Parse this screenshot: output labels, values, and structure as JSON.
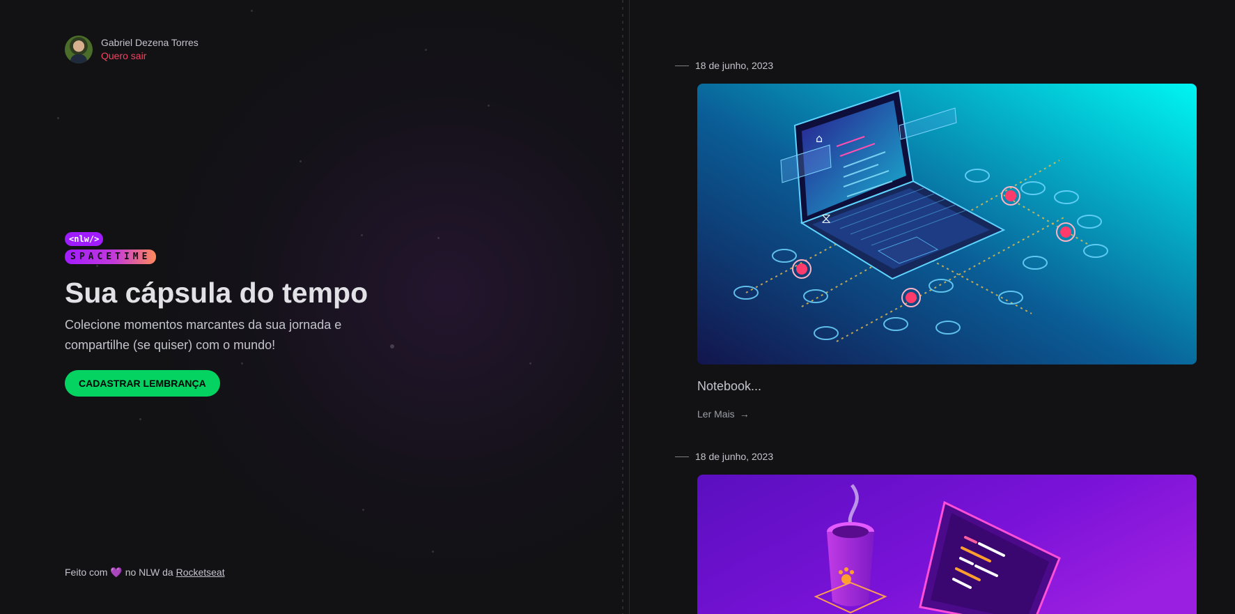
{
  "profile": {
    "name": "Gabriel Dezena Torres",
    "logout_label": "Quero sair"
  },
  "logo": {
    "badge": "<nlw/>",
    "word": "SPACETIME"
  },
  "hero": {
    "title": "Sua cápsula do tempo",
    "description": "Colecione momentos marcantes da sua jornada e compartilhe (se quiser) com o mundo!",
    "cta_label": "Cadastrar lembrança"
  },
  "footer": {
    "prefix": "Feito com",
    "heart": "💜",
    "middle": "no NLW da",
    "link": "Rocketseat"
  },
  "memories": [
    {
      "date": "18 de junho, 2023",
      "excerpt": "Notebook...",
      "more_label": "Ler Mais",
      "image_icon": "isometric-laptop-network-illustration"
    },
    {
      "date": "18 de junho, 2023",
      "image_icon": "isometric-coffee-laptop-illustration"
    }
  ],
  "colors": {
    "background": "#121215",
    "accent_green": "#04d361",
    "logout_red": "#f3425f",
    "brand_purple": "#a21cff",
    "brand_orange": "#ff8a5b"
  }
}
